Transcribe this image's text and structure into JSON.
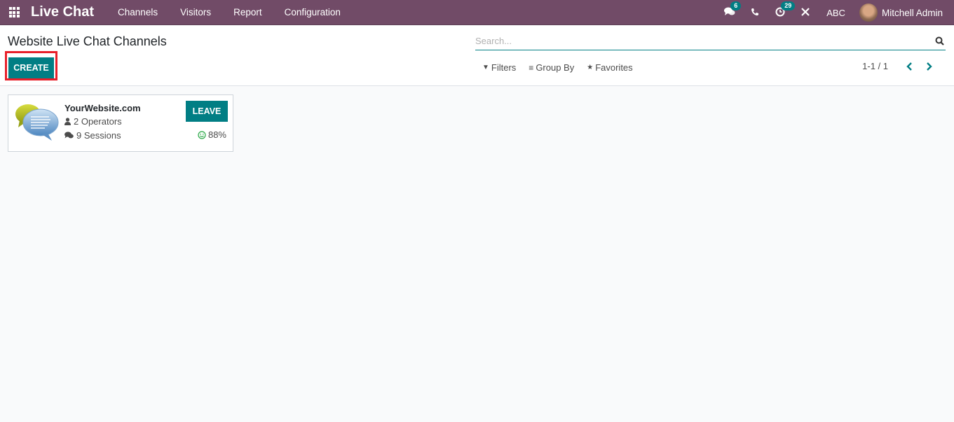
{
  "navbar": {
    "app_name": "Live Chat",
    "menu": [
      "Channels",
      "Visitors",
      "Report",
      "Configuration"
    ],
    "messages_badge": "6",
    "activities_badge": "29",
    "company": "ABC",
    "user_name": "Mitchell Admin",
    "icons": [
      "apps-grid-icon",
      "chat-icon",
      "phone-icon",
      "clock-icon",
      "debug-tools-icon"
    ]
  },
  "control_panel": {
    "title": "Website Live Chat Channels",
    "create_label": "CREATE",
    "search_placeholder": "Search...",
    "filters_label": "Filters",
    "group_by_label": "Group By",
    "favorites_label": "Favorites",
    "pager_value": "1-1 / 1"
  },
  "colors": {
    "navbar": "#714b67",
    "primary": "#017e84",
    "highlight_outline": "#e8202a"
  },
  "channels": [
    {
      "name": "YourWebsite.com",
      "operators": "2 Operators",
      "sessions": "9 Sessions",
      "rating": "88%",
      "action_label": "LEAVE"
    }
  ]
}
